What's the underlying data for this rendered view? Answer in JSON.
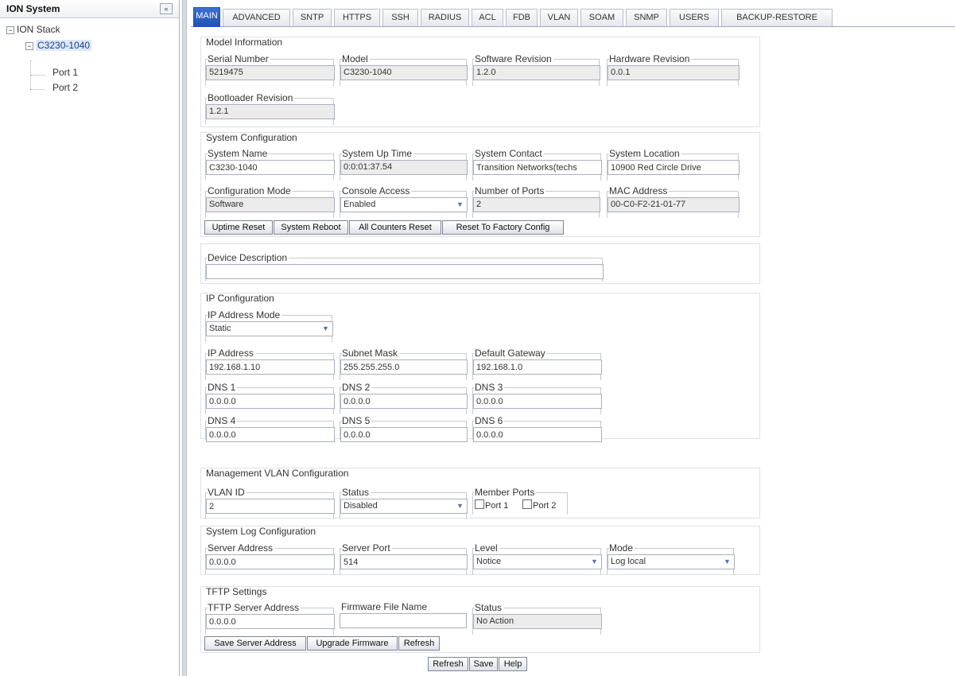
{
  "tree": {
    "title": "ION System",
    "collapse_icon": "«",
    "stack_label": "ION Stack",
    "device_label": "C3230-1040",
    "port1": "Port 1",
    "port2": "Port 2",
    "minus": "−"
  },
  "tabs": [
    "MAIN",
    "ADVANCED",
    "SNTP",
    "HTTPS",
    "SSH",
    "RADIUS",
    "ACL",
    "FDB",
    "VLAN",
    "SOAM",
    "SNMP",
    "USERS",
    "BACKUP-RESTORE"
  ],
  "model_info": {
    "legend": "Model Information",
    "serial_label": "Serial Number",
    "serial": "5219475",
    "model_label": "Model",
    "model": "C3230-1040",
    "sw_label": "Software Revision",
    "sw": "1.2.0",
    "hw_label": "Hardware Revision",
    "hw": "0.0.1",
    "boot_label": "Bootloader Revision",
    "boot": "1.2.1"
  },
  "sys_config": {
    "legend": "System Configuration",
    "name_label": "System Name",
    "name": "C3230-1040",
    "uptime_label": "System Up Time",
    "uptime": "0:0:01:37.54",
    "contact_label": "System Contact",
    "contact": "Transition Networks(techs",
    "location_label": "System Location",
    "location": "10900 Red Circle Drive",
    "mode_label": "Configuration Mode",
    "mode": "Software",
    "console_label": "Console Access",
    "console": "Enabled",
    "ports_label": "Number of Ports",
    "ports": "2",
    "mac_label": "MAC Address",
    "mac": "00-C0-F2-21-01-77",
    "btn_uptime_reset": "Uptime Reset",
    "btn_reboot": "System Reboot",
    "btn_counters_reset": "All Counters Reset",
    "btn_factory": "Reset To Factory Config"
  },
  "device_desc": {
    "label": "Device Description",
    "value": ""
  },
  "ip_config": {
    "legend": "IP Configuration",
    "mode_label": "IP Address Mode",
    "mode": "Static",
    "ip_label": "IP Address",
    "ip": "192.168.1.10",
    "mask_label": "Subnet Mask",
    "mask": "255.255.255.0",
    "gw_label": "Default Gateway",
    "gw": "192.168.1.0",
    "dns1_label": "DNS 1",
    "dns1": "0.0.0.0",
    "dns2_label": "DNS 2",
    "dns2": "0.0.0.0",
    "dns3_label": "DNS 3",
    "dns3": "0.0.0.0",
    "dns4_label": "DNS 4",
    "dns4": "0.0.0.0",
    "dns5_label": "DNS 5",
    "dns5": "0.0.0.0",
    "dns6_label": "DNS 6",
    "dns6": "0.0.0.0"
  },
  "mgmt_vlan": {
    "legend": "Management VLAN Configuration",
    "vlan_label": "VLAN ID",
    "vlan": "2",
    "status_label": "Status",
    "status": "Disabled",
    "members_label": "Member Ports",
    "port1": "Port 1",
    "port2": "Port 2"
  },
  "syslog": {
    "legend": "System Log Configuration",
    "server_label": "Server Address",
    "server": "0.0.0.0",
    "port_label": "Server Port",
    "port": "514",
    "level_label": "Level",
    "level": "Notice",
    "mode_label": "Mode",
    "mode": "Log local"
  },
  "tftp": {
    "legend": "TFTP Settings",
    "server_label": "TFTP Server Address",
    "server": "0.0.0.0",
    "file_label": "Firmware File Name",
    "file": "",
    "status_label": "Status",
    "status": "No Action",
    "btn_save_server": "Save Server Address",
    "btn_upgrade": "Upgrade Firmware",
    "btn_refresh": "Refresh"
  },
  "footer": {
    "refresh": "Refresh",
    "save": "Save",
    "help": "Help"
  },
  "icons": {
    "dropdown": "▼"
  }
}
